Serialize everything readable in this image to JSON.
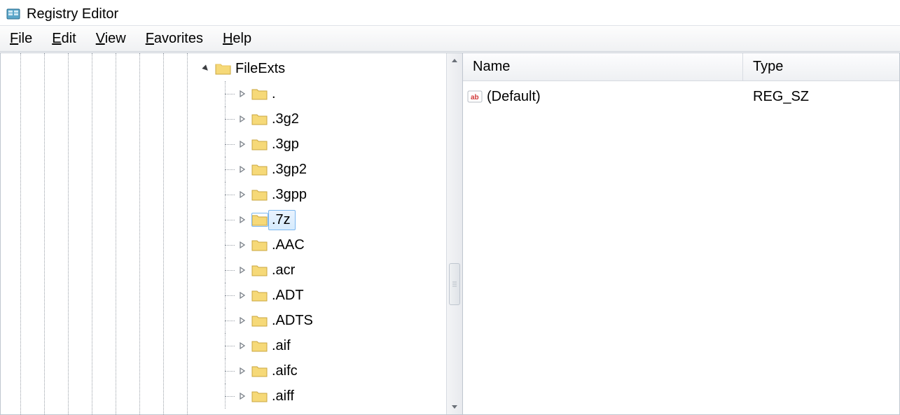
{
  "window": {
    "title": "Registry Editor"
  },
  "menu": {
    "file": {
      "label": "File",
      "ul": "F"
    },
    "edit": {
      "label": "Edit",
      "ul": "E"
    },
    "view": {
      "label": "View",
      "ul": "V"
    },
    "favorites": {
      "label": "Favorites",
      "ul": "F"
    },
    "help": {
      "label": "Help",
      "ul": "H"
    }
  },
  "tree": {
    "root": {
      "label": "FileExts",
      "expanded": true
    },
    "children": [
      {
        "label": ".",
        "selected": false
      },
      {
        "label": ".3g2",
        "selected": false
      },
      {
        "label": ".3gp",
        "selected": false
      },
      {
        "label": ".3gp2",
        "selected": false
      },
      {
        "label": ".3gpp",
        "selected": false
      },
      {
        "label": ".7z",
        "selected": true
      },
      {
        "label": ".AAC",
        "selected": false
      },
      {
        "label": ".acr",
        "selected": false
      },
      {
        "label": ".ADT",
        "selected": false
      },
      {
        "label": ".ADTS",
        "selected": false
      },
      {
        "label": ".aif",
        "selected": false
      },
      {
        "label": ".aifc",
        "selected": false
      },
      {
        "label": ".aiff",
        "selected": false
      }
    ]
  },
  "list": {
    "columns": {
      "name": "Name",
      "type": "Type"
    },
    "rows": [
      {
        "name": "(Default)",
        "type": "REG_SZ",
        "icon": "string-value-icon"
      }
    ]
  }
}
